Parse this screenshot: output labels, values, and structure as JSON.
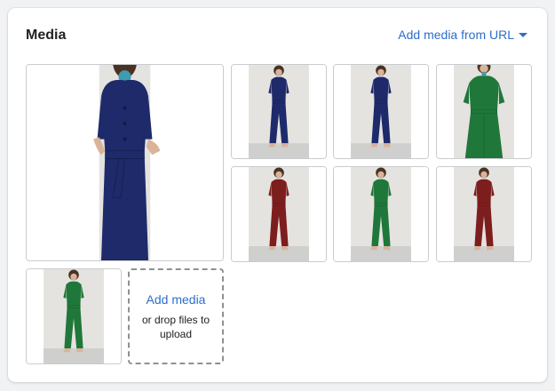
{
  "media": {
    "title": "Media",
    "add_from_url": "Add media from URL",
    "upload": {
      "title": "Add media",
      "hint": "or drop files to upload"
    },
    "images": [
      {
        "name": "media-image-navy-jumpsuit-closeup",
        "garment_color": "#1e2a6a",
        "pose": "closeup"
      },
      {
        "name": "media-image-navy-jumpsuit-front",
        "garment_color": "#1e2a6a",
        "pose": "full"
      },
      {
        "name": "media-image-navy-jumpsuit-side",
        "garment_color": "#1e2a6a",
        "pose": "full"
      },
      {
        "name": "media-image-green-jumpsuit-front",
        "garment_color": "#20773a",
        "pose": "half"
      },
      {
        "name": "media-image-red-jumpsuit-front",
        "garment_color": "#7d1e1e",
        "pose": "full"
      },
      {
        "name": "media-image-green-jumpsuit-full",
        "garment_color": "#20773a",
        "pose": "full"
      },
      {
        "name": "media-image-red-jumpsuit-full",
        "garment_color": "#7d1e1e",
        "pose": "full"
      },
      {
        "name": "media-image-green-jumpsuit-side",
        "garment_color": "#20773a",
        "pose": "full"
      }
    ]
  },
  "colors": {
    "accent": "#2c6ecb",
    "backdrop": "#e4e3df",
    "skin": "#d9b39a",
    "hair": "#4a3222",
    "floor": "#cfcfcd"
  }
}
